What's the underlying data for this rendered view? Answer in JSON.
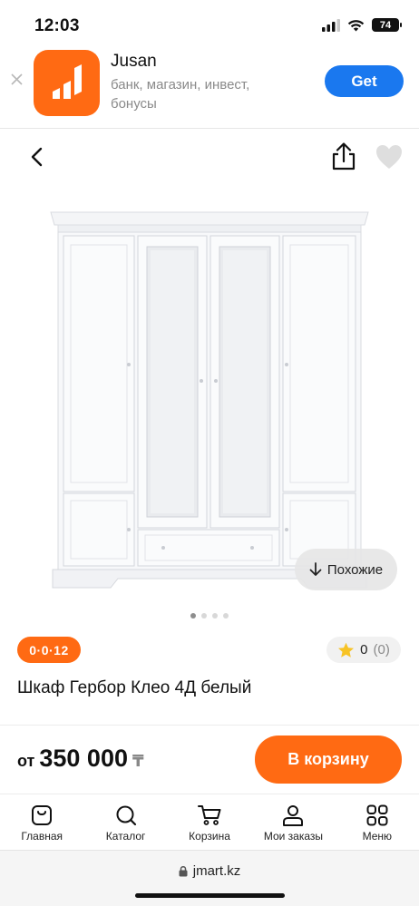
{
  "status_bar": {
    "time": "12:03",
    "battery": "74"
  },
  "app_banner": {
    "app_name": "Jusan",
    "description": "банк, магазин, инвест, бонусы",
    "get_label": "Get",
    "brand_color": "#ff6a13",
    "button_color": "#1a78ef"
  },
  "product": {
    "similar_label": "Похожие",
    "image_count": 4,
    "active_image": 1,
    "installment_label": "0·0·12",
    "rating_value": "0",
    "rating_count": "(0)",
    "title": "Шкаф Гербор Клео 4Д белый"
  },
  "purchase": {
    "price_prefix": "от",
    "price": "350 000",
    "currency": "₸",
    "cart_label": "В корзину",
    "accent_color": "#ff6a13"
  },
  "bottom_nav": [
    {
      "label": "Главная",
      "icon": "bag-icon"
    },
    {
      "label": "Каталог",
      "icon": "search-icon"
    },
    {
      "label": "Корзина",
      "icon": "cart-icon"
    },
    {
      "label": "Мои заказы",
      "icon": "user-icon"
    },
    {
      "label": "Меню",
      "icon": "menu-grid-icon"
    }
  ],
  "browser": {
    "url": "jmart.kz"
  }
}
